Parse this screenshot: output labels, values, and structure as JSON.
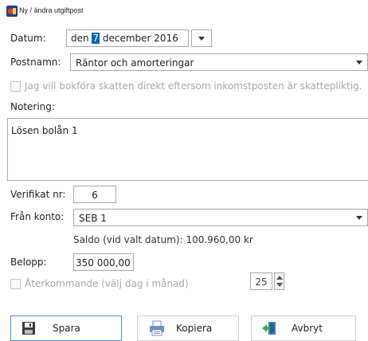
{
  "window": {
    "title": "Ny / ändra utgiftpost"
  },
  "form": {
    "date": {
      "label": "Datum:",
      "prefix": "den ",
      "selected": "7",
      "rest": " december 2016"
    },
    "post": {
      "label": "Postnamn:",
      "value": "Räntor och amorteringar"
    },
    "tax_checkbox": {
      "label": "Jag vill bokföra skatten direkt eftersom inkomstposten är skattepliktig.",
      "checked": false
    },
    "note": {
      "label": "Notering:",
      "value": "Lösen bolån 1"
    },
    "voucher": {
      "label": "Verifikat nr:",
      "value": "6"
    },
    "from_account": {
      "label": "Från konto:",
      "value": "SEB 1"
    },
    "balance": "Saldo (vid valt datum): 100.960,00 kr",
    "amount": {
      "label": "Belopp:",
      "value": "350 000,00"
    },
    "recurring": {
      "label": "Återkommande (välj dag i månad)",
      "checked": false,
      "day": "25"
    }
  },
  "buttons": {
    "save": "Spara",
    "copy": "Kopiera",
    "cancel": "Avbryt"
  },
  "icons": {
    "app": "app-logo-icon",
    "save": "floppy-disk-icon",
    "copy": "printer-copy-icon",
    "cancel": "exit-door-icon"
  },
  "colors": {
    "selection": "#0a64b8",
    "primary_border": "#4a8fd6",
    "disabled_text": "#a8a8a8"
  }
}
